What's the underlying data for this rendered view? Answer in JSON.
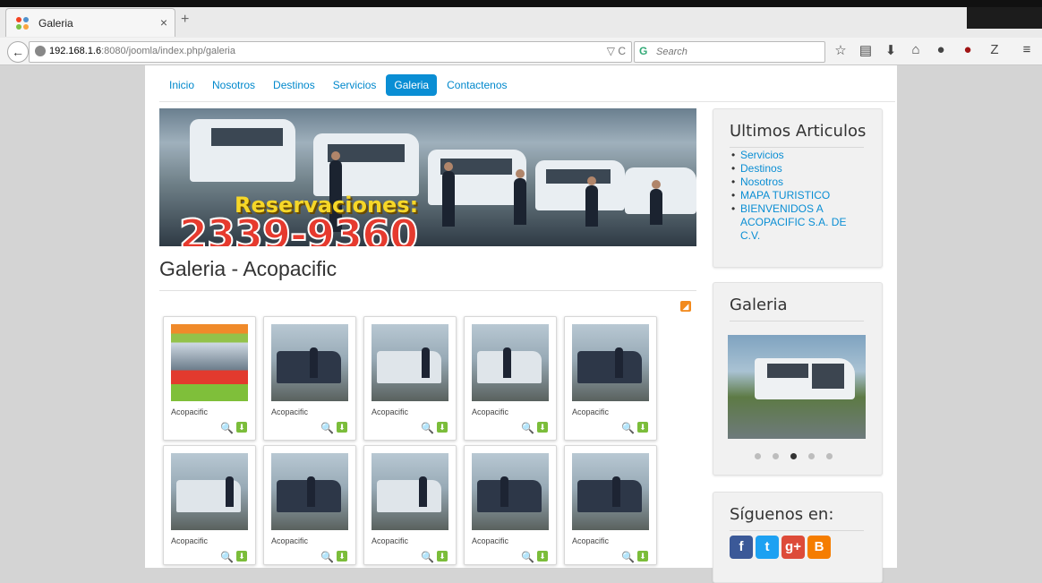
{
  "browser": {
    "tab_title": "Galeria",
    "tab_close": "×",
    "new_tab": "+",
    "url_host": "192.168.1.6",
    "url_rest": ":8080/joomla/index.php/galeria",
    "search_placeholder": "Search",
    "url_icons": "▽ C"
  },
  "nav": {
    "items": [
      "Inicio",
      "Nosotros",
      "Destinos",
      "Servicios",
      "Galeria",
      "Contactenos"
    ],
    "active_index": 4
  },
  "banner": {
    "reservation_text": "Reservaciones:",
    "phone": "2339-9360"
  },
  "page": {
    "title": "Galeria - Acopacific"
  },
  "gallery": {
    "item_label": "Acopacific",
    "items": [
      "Acopacific",
      "Acopacific",
      "Acopacific",
      "Acopacific",
      "Acopacific",
      "Acopacific",
      "Acopacific",
      "Acopacific",
      "Acopacific",
      "Acopacific"
    ]
  },
  "sidebar": {
    "latest": {
      "title": "Ultimos Articulos",
      "items": [
        "Servicios",
        "Destinos",
        "Nosotros",
        "MAPA TURISTICO",
        "BIENVENIDOS A ACOPACIFIC S.A. DE C.V."
      ]
    },
    "gallery": {
      "title": "Galeria",
      "dots": 5,
      "active_dot": 2
    },
    "social": {
      "title": "Síguenos en:",
      "networks": [
        "f",
        "t",
        "g+",
        "B"
      ]
    }
  },
  "colors": {
    "link": "#08c",
    "active_tab_bg": "#0a8ed4",
    "facebook": "#3b5998",
    "twitter": "#1da1f2",
    "googleplus": "#dd4b39",
    "blogger": "#f57d00"
  }
}
